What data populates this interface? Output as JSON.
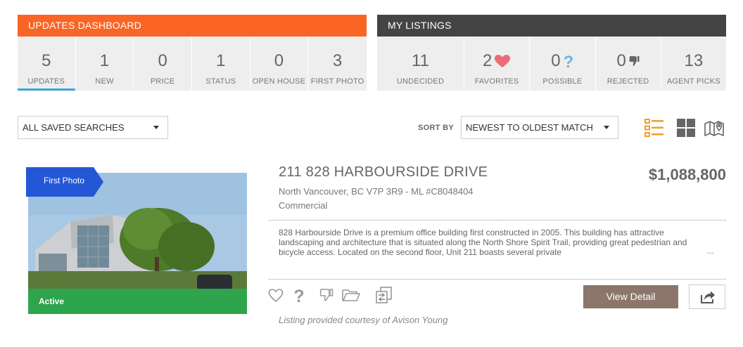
{
  "updates_dashboard": {
    "title": "UPDATES DASHBOARD",
    "stats": [
      {
        "value": "5",
        "label": "UPDATES"
      },
      {
        "value": "1",
        "label": "NEW"
      },
      {
        "value": "0",
        "label": "PRICE"
      },
      {
        "value": "1",
        "label": "STATUS"
      },
      {
        "value": "0",
        "label": "OPEN HOUSE"
      },
      {
        "value": "3",
        "label": "FIRST PHOTO"
      }
    ]
  },
  "my_listings": {
    "title": "MY LISTINGS",
    "stats": [
      {
        "value": "11",
        "label": "UNDECIDED"
      },
      {
        "value": "2",
        "label": "FAVORITES",
        "icon": "heart-icon"
      },
      {
        "value": "0",
        "label": "POSSIBLE",
        "icon": "question-icon"
      },
      {
        "value": "0",
        "label": "REJECTED",
        "icon": "thumbs-down-icon"
      },
      {
        "value": "13",
        "label": "AGENT PICKS"
      }
    ]
  },
  "filters": {
    "saved_searches": "ALL SAVED SEARCHES",
    "sort_label": "SORT BY",
    "sort_value": "NEWEST TO OLDEST MATCH"
  },
  "view_icons": [
    "list-view-icon",
    "grid-view-icon",
    "map-view-icon"
  ],
  "listing": {
    "badge": "First Photo",
    "status": "Active",
    "address": "211 828 HARBOURSIDE DRIVE",
    "price": "$1,088,800",
    "location": "North Vancouver, BC V7P 3R9 - ML #C8048404",
    "type": "Commercial",
    "description": "828 Harbourside Drive is a premium office building first constructed in 2005. This building has attractive landscaping and architecture that is situated along the North Shore Spirit Trail, providing great pedestrian and bicycle access. Located on the second floor, Unit 211 boasts several private",
    "ellipsis": "...",
    "view_detail": "View Detail",
    "courtesy": "Listing provided courtesy of Avison Young"
  },
  "colors": {
    "updates_header": "#fa6425",
    "listings_header": "#444444",
    "active_tab": "#3aa6dc",
    "accent_orange": "#f39b2f",
    "heart": "#ee6a78",
    "question": "#6fb5e2",
    "view_detail": "#8c766c",
    "badge": "#2457d6",
    "status_strip": "#27a049"
  }
}
